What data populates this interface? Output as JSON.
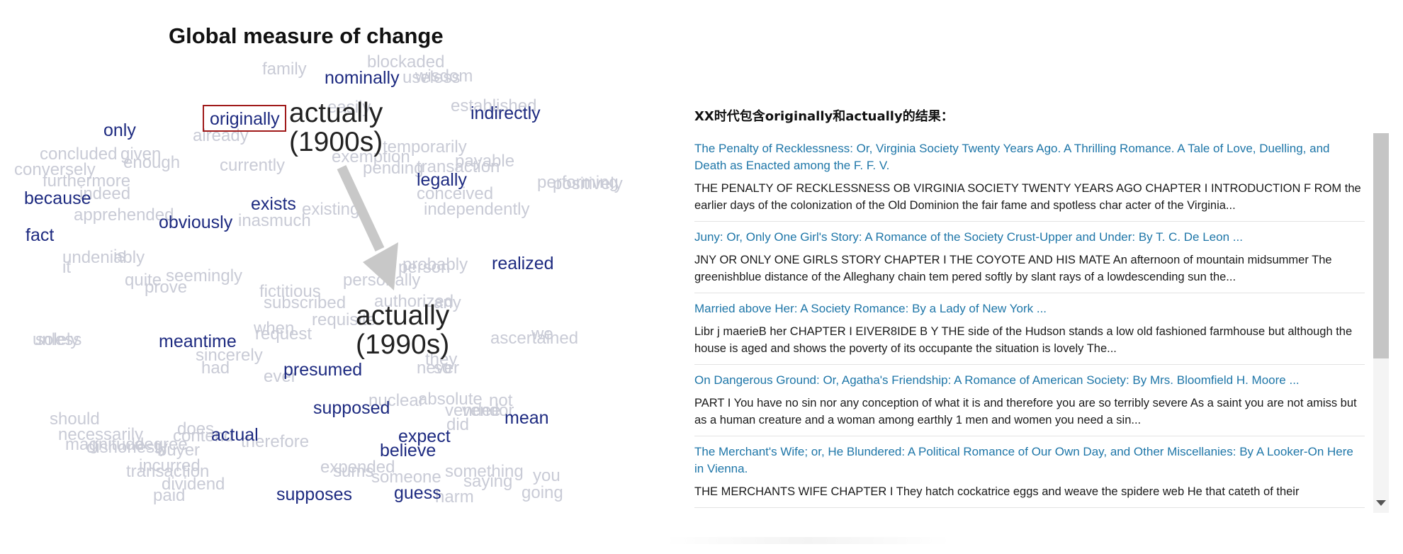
{
  "diagram": {
    "title": "Global measure of change",
    "anchors": {
      "past": "actually\n(1900s)",
      "present": "actually\n(1990s)"
    },
    "highlighted_word": "originally",
    "dark_words": [
      "nominally",
      "indirectly",
      "only",
      "because",
      "fact",
      "legally",
      "exists",
      "obviously",
      "realized",
      "meantime",
      "presumed",
      "supposed",
      "mean",
      "actual",
      "expect",
      "believe",
      "supposes",
      "guess"
    ],
    "faded_words": [
      "family",
      "blockaded",
      "wisdom",
      "useless",
      "easily",
      "established",
      "already",
      "temporarily",
      "concluded",
      "given",
      "conversely",
      "enough",
      "furthermore",
      "indeed",
      "currently",
      "exemption",
      "pending",
      "transaction",
      "payable",
      "performing",
      "positively",
      "conceived",
      "apprehended",
      "inasmuch",
      "existing",
      "independently",
      "undeniably",
      "it",
      "is",
      "quite",
      "seemingly",
      "prove",
      "probably",
      "person",
      "personally",
      "fictitious",
      "subscribed",
      "authorized",
      "any",
      "when",
      "request",
      "requisite",
      "unless",
      "solely",
      "sincerely",
      "had",
      "ever",
      "never",
      "ascertained",
      "we",
      "they",
      "so",
      "nuclear",
      "absolute",
      "not",
      "should",
      "necessarily",
      "vendee",
      "vendor",
      "did",
      "does",
      "contend",
      "therefore",
      "degree",
      "magnitude",
      "dishonesty",
      "buyer",
      "transaction",
      "incurred",
      "dividend",
      "paid",
      "expended",
      "sums",
      "someone",
      "something",
      "saying",
      "you",
      "going",
      "harm",
      "done",
      "doubt"
    ]
  },
  "results": {
    "heading": "XX时代包含originally和actually的结果：",
    "items": [
      {
        "title": "The Penalty of Recklessness: Or, Virginia Society Twenty Years Ago. A Thrilling Romance. A Tale of Love, Duelling, and Death as Enacted among the F. F. V.",
        "snippet": "THE PENALTY OF RECKLESSNESS OB VIRGINIA SOCIETY TWENTY YEARS AGO CHAPTER I INTRODUCTION F ROM the earlier days of the colonization of the Old Dominion the fair fame and spotless char acter of the Virginia..."
      },
      {
        "title": "Juny: Or, Only One Girl's Story: A Romance of the Society Crust-Upper and Under: By T. C. De Leon ...",
        "snippet": "JNY OR ONLY ONE GIRLS STORY CHAPTER I THE COYOTE AND HIS MATE An afternoon of mountain midsummer The greenishblue distance of the Alleghany chain tem pered softly by slant rays of a lowdescending sun the..."
      },
      {
        "title": "Married above Her: A Society Romance: By a Lady of New York ...",
        "snippet": "Libr j maerieB her CHAPTER I EIVER8IDE B Y THE side of the Hudson stands a low old fashioned farmhouse but although the house is aged and shows the poverty of its occupante the situation is lovely The..."
      },
      {
        "title": "On Dangerous Ground: Or, Agatha's Friendship: A Romance of American Society: By Mrs. Bloomfield H. Moore ...",
        "snippet": "PART I You have no sin nor any conception of what it is and therefore you are so terribly severe As a saint you are not amiss but as a human creature and a woman among earthly 1 men and women you need a sin..."
      },
      {
        "title": "The Merchant's Wife; or, He Blundered: A Political Romance of Our Own Day, and Other Miscellanies: By A Looker-On Here in Vienna.",
        "snippet": "THE MERCHANTS WIFE CHAPTER I They hatch cockatrice eggs and weave the spidere web He that cateth of their"
      }
    ]
  },
  "colors": {
    "dark_word": "#1d2a80",
    "faded_word": "#c9cbd6",
    "highlight_box": "#a01a1a",
    "link": "#1e76a8",
    "arrow": "#c8c8c8"
  },
  "icons": {
    "scroll_down": "scroll-down-arrow-icon"
  }
}
